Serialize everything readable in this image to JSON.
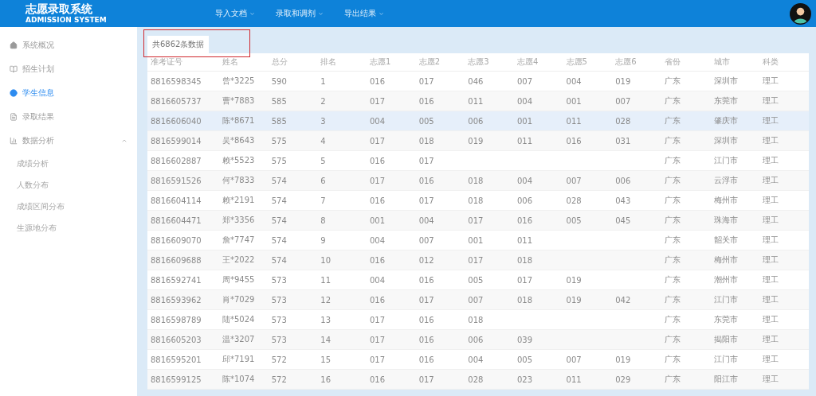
{
  "header": {
    "title": "志愿录取系统",
    "subtitle": "ADMISSION SYSTEM",
    "menu": [
      {
        "label": "导入文档"
      },
      {
        "label": "录取和调剂"
      },
      {
        "label": "导出结果"
      }
    ]
  },
  "sidebar": {
    "items": [
      {
        "label": "系统概况",
        "selected": false
      },
      {
        "label": "招生计划",
        "selected": false
      },
      {
        "label": "学生信息",
        "selected": true
      },
      {
        "label": "录取结果",
        "selected": false
      },
      {
        "label": "数据分析",
        "selected": false,
        "expanded": true,
        "children": [
          {
            "label": "成绩分析",
            "selected": false
          },
          {
            "label": "人数分布",
            "selected": false
          },
          {
            "label": "成绩区间分布",
            "selected": false
          },
          {
            "label": "生源地分布",
            "selected": false
          }
        ]
      }
    ]
  },
  "count_tab": {
    "label": "共6862条数据",
    "highlighted": true
  },
  "table": {
    "columns": [
      "准考证号",
      "姓名",
      "总分",
      "排名",
      "志愿1",
      "志愿2",
      "志愿3",
      "志愿4",
      "志愿5",
      "志愿6",
      "省份",
      "城市",
      "科类"
    ],
    "rows": [
      {
        "id": "8816598345",
        "name": "曾*3225",
        "score": "590",
        "rank": "1",
        "choices": [
          "016",
          "017",
          "046",
          "007",
          "004",
          "019"
        ],
        "province": "广东",
        "city": "深圳市",
        "category": "理工",
        "hovered": false
      },
      {
        "id": "8816605737",
        "name": "曹*7883",
        "score": "585",
        "rank": "2",
        "choices": [
          "017",
          "016",
          "011",
          "004",
          "001",
          "007"
        ],
        "province": "广东",
        "city": "东莞市",
        "category": "理工",
        "hovered": false
      },
      {
        "id": "8816606040",
        "name": "陈*8671",
        "score": "585",
        "rank": "3",
        "choices": [
          "004",
          "005",
          "006",
          "001",
          "011",
          "028"
        ],
        "province": "广东",
        "city": "肇庆市",
        "category": "理工",
        "hovered": true
      },
      {
        "id": "8816599014",
        "name": "吴*8643",
        "score": "575",
        "rank": "4",
        "choices": [
          "017",
          "018",
          "019",
          "011",
          "016",
          "031"
        ],
        "province": "广东",
        "city": "深圳市",
        "category": "理工",
        "hovered": false
      },
      {
        "id": "8816602887",
        "name": "赖*5523",
        "score": "575",
        "rank": "5",
        "choices": [
          "016",
          "017"
        ],
        "province": "广东",
        "city": "江门市",
        "category": "理工",
        "hovered": false
      },
      {
        "id": "8816591526",
        "name": "何*7833",
        "score": "574",
        "rank": "6",
        "choices": [
          "017",
          "016",
          "018",
          "004",
          "007",
          "006"
        ],
        "province": "广东",
        "city": "云浮市",
        "category": "理工",
        "hovered": false
      },
      {
        "id": "8816604114",
        "name": "赖*2191",
        "score": "574",
        "rank": "7",
        "choices": [
          "016",
          "017",
          "018",
          "006",
          "028",
          "043"
        ],
        "province": "广东",
        "city": "梅州市",
        "category": "理工",
        "hovered": false
      },
      {
        "id": "8816604471",
        "name": "郑*3356",
        "score": "574",
        "rank": "8",
        "choices": [
          "001",
          "004",
          "017",
          "016",
          "005",
          "045"
        ],
        "province": "广东",
        "city": "珠海市",
        "category": "理工",
        "hovered": false
      },
      {
        "id": "8816609070",
        "name": "詹*7747",
        "score": "574",
        "rank": "9",
        "choices": [
          "004",
          "007",
          "001",
          "011"
        ],
        "province": "广东",
        "city": "韶关市",
        "category": "理工",
        "hovered": false
      },
      {
        "id": "8816609688",
        "name": "王*2022",
        "score": "574",
        "rank": "10",
        "choices": [
          "016",
          "012",
          "017",
          "018"
        ],
        "province": "广东",
        "city": "梅州市",
        "category": "理工",
        "hovered": false
      },
      {
        "id": "8816592741",
        "name": "周*9455",
        "score": "573",
        "rank": "11",
        "choices": [
          "004",
          "016",
          "005",
          "017",
          "019"
        ],
        "province": "广东",
        "city": "潮州市",
        "category": "理工",
        "hovered": false
      },
      {
        "id": "8816593962",
        "name": "肖*7029",
        "score": "573",
        "rank": "12",
        "choices": [
          "016",
          "017",
          "007",
          "018",
          "019",
          "042"
        ],
        "province": "广东",
        "city": "江门市",
        "category": "理工",
        "hovered": false
      },
      {
        "id": "8816598789",
        "name": "陆*5024",
        "score": "573",
        "rank": "13",
        "choices": [
          "017",
          "016",
          "018"
        ],
        "province": "广东",
        "city": "东莞市",
        "category": "理工",
        "hovered": false
      },
      {
        "id": "8816605203",
        "name": "温*3207",
        "score": "573",
        "rank": "14",
        "choices": [
          "017",
          "016",
          "006",
          "039"
        ],
        "province": "广东",
        "city": "揭阳市",
        "category": "理工",
        "hovered": false
      },
      {
        "id": "8816595201",
        "name": "邱*7191",
        "score": "572",
        "rank": "15",
        "choices": [
          "017",
          "016",
          "004",
          "005",
          "007",
          "019"
        ],
        "province": "广东",
        "city": "江门市",
        "category": "理工",
        "hovered": false
      },
      {
        "id": "8816599125",
        "name": "陈*1074",
        "score": "572",
        "rank": "16",
        "choices": [
          "016",
          "017",
          "028",
          "023",
          "011",
          "029"
        ],
        "province": "广东",
        "city": "阳江市",
        "category": "理工",
        "hovered": false
      }
    ]
  }
}
